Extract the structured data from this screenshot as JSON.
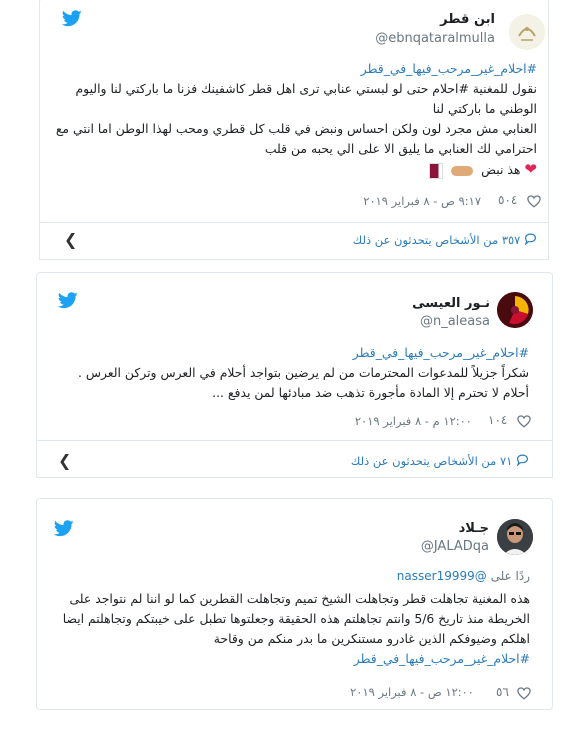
{
  "tweets": [
    {
      "name": "ابن قطر",
      "handle": "@ebnqataralmulla",
      "hashtag": "#احلام_غير_مرحب_فيها_في_قطر",
      "lines": [
        "نقول للمغنية #احلام حتى لو لبستي عنابي ترى اهل قطر كاشفينك فزنا ما باركتي لنا واليوم",
        "الوطني ما باركتي لنا",
        "العنابي مش مجرد لون ولكن احساس ونبض في قلب كل قطري ومحب لهذا الوطن اما انتي مع",
        "احترامي لك العنابي ما يليق الا على الي يحبه من قلب",
        "هذ نبض"
      ],
      "emoji": "❤",
      "flag_emoji": "🇶🇦",
      "likes": "٥٠٤",
      "timestamp": "٩:١٧ ص - ٨ فبراير ٢٠١٩",
      "reply_text": "٣٥٧ من الأشخاص يتحدثون عن ذلك"
    },
    {
      "name": "نـور العيسى",
      "handle": "@n_aleasa",
      "hashtag": "#احلام_غير_مرحب_فيها_في_قطر",
      "lines": [
        "شكراً جزيلاً للمدعوات المحترمات من لم يرضين بتواجد أحلام في العرس وتركن العرس .",
        "أحلام لا تحترم إلا المادة مأجورة تذهب ضد مبادئها لمن يدفع ..."
      ],
      "likes": "١٠٤",
      "timestamp": "١٢:٠٠ م - ٨ فبراير ٢٠١٩",
      "reply_text": "٧١ من الأشخاص يتحدثون عن ذلك"
    },
    {
      "name": "جـلاد",
      "handle": "@JALADqa",
      "reply_to_prefix": "ردًا على",
      "reply_to_handle": "@nasser19999",
      "lines": [
        "هذه المغنية تجاهلت قطر وتجاهلت الشيخ تميم وتجاهلت القطرين كما لو اننا لم نتواجد على",
        "الخريطة منذ تاريخ 5/6 وانتم تجاهلتم هذه الحقيقة وجعلتوها تطبل على خيبتكم وتجاهلتم ايضا",
        "اهلكم وضيوفكم الذين غادرو مستنكرين ما بدر منكم من وقاحة"
      ],
      "hashtag": "#احلام_غير_مرحب_فيها_في_قطر",
      "likes": "٥٦",
      "timestamp": "١٢:٠٠ ص - ٨ فبراير ٢٠١٩"
    }
  ],
  "icons": {
    "bird": "twitter-bird-icon",
    "heart": "heart-outline-icon",
    "reply": "speech-bubble-icon",
    "chevron": "chevron-left-icon"
  },
  "colors": {
    "twitter_blue": "#1da1f2",
    "link": "#2b7bb9",
    "muted": "#697882",
    "border": "#e1e8ed",
    "heart": "#e0245e"
  }
}
